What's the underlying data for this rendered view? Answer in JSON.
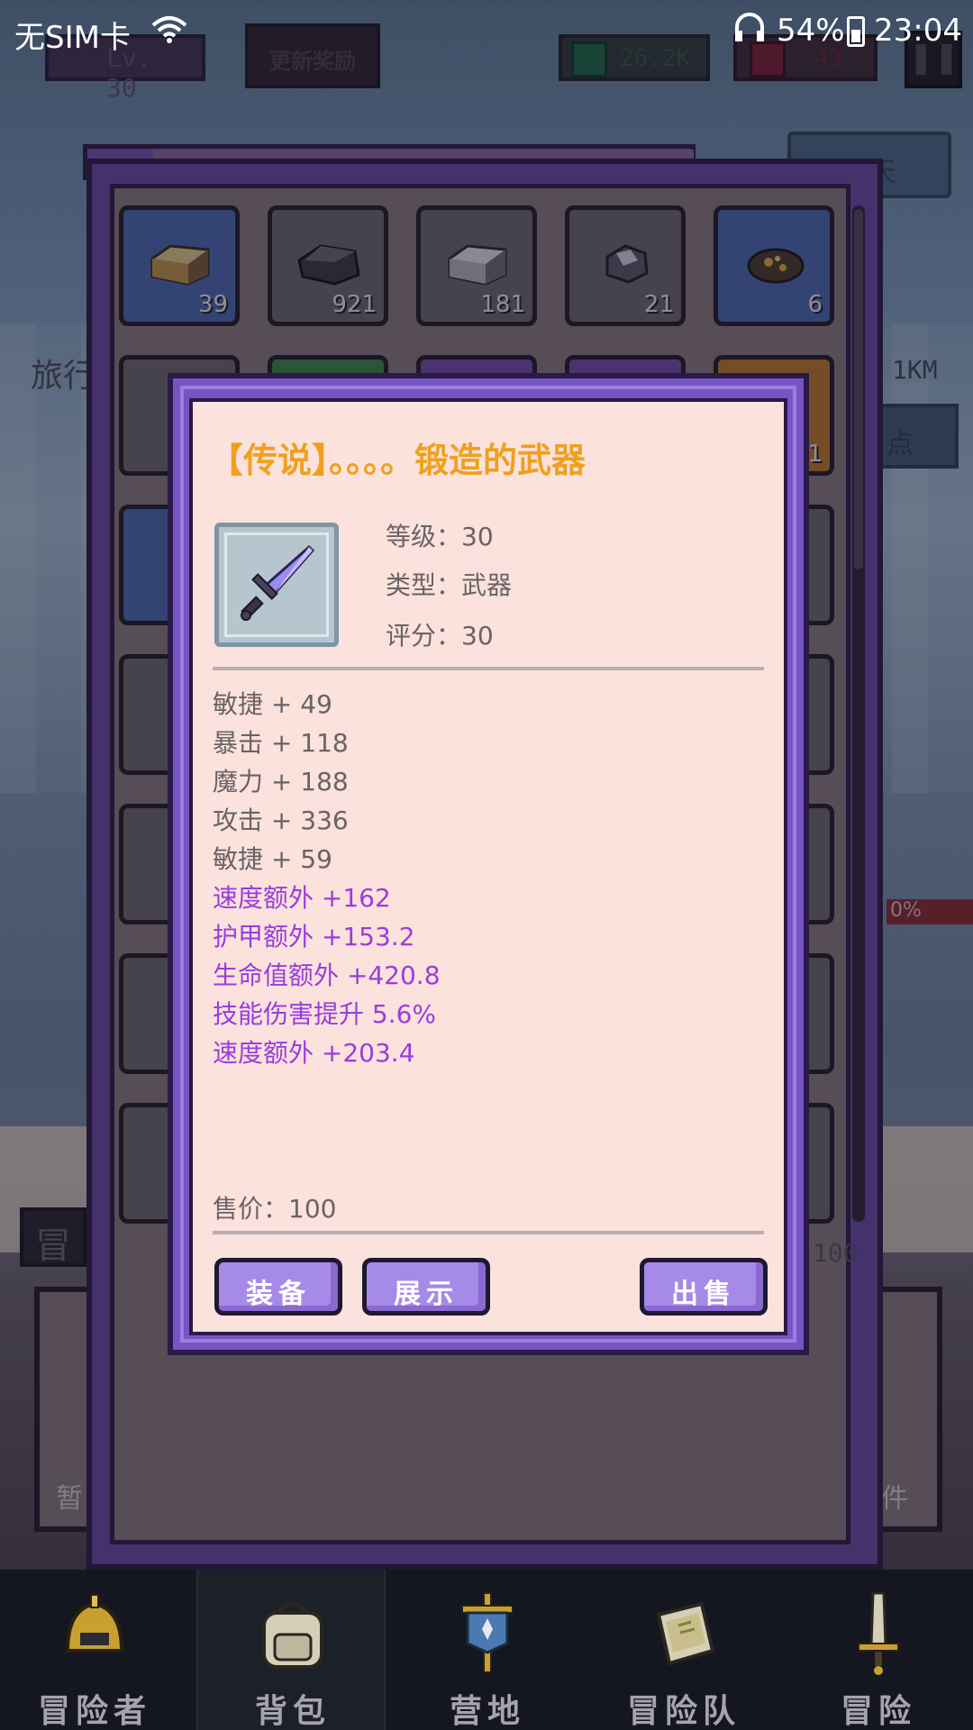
{
  "status_bar": {
    "carrier": "无SIM卡",
    "battery": "54%",
    "time": "23:04"
  },
  "hud": {
    "level": "Lv. 30",
    "event_button": "更新奖励",
    "gems": "26.2K",
    "rubies": "43"
  },
  "side": {
    "chat": "聊天",
    "travel": "旅行",
    "distance": "1KM",
    "right_button": "点",
    "percent": "0%",
    "adventure_short": "冒",
    "capacity": "100",
    "left_chip": "暂",
    "right_chip": "件"
  },
  "backpack": {
    "slots_row1": [
      {
        "count": "39",
        "tier": "blue",
        "material": "gold-ingot"
      },
      {
        "count": "921",
        "tier": "gray",
        "material": "coal"
      },
      {
        "count": "181",
        "tier": "gray",
        "material": "iron-ingot"
      },
      {
        "count": "21",
        "tier": "gray",
        "material": "silver-ore"
      },
      {
        "count": "6",
        "tier": "blue",
        "material": "gold-ore"
      }
    ],
    "slots_row2": [
      {
        "count": "",
        "tier": "gray"
      },
      {
        "count": "",
        "tier": "green"
      },
      {
        "count": "",
        "tier": "purple"
      },
      {
        "count": "",
        "tier": "purple"
      },
      {
        "count": "1",
        "tier": "orange"
      }
    ]
  },
  "item_detail": {
    "title": "【传说】。。。。锻造的武器",
    "title_color": "#f0a020",
    "icon": "sword-icon",
    "level_label": "等级：30",
    "type_label": "类型：武器",
    "score_label": "评分：30",
    "base_attrs": [
      "敏捷 + 49",
      "暴击 + 118",
      "魔力 + 188",
      "攻击 + 336",
      "敏捷 + 59"
    ],
    "bonus_attrs": [
      "速度额外 +162",
      "护甲额外 +153.2",
      "生命值额外 +420.8",
      "技能伤害提升 5.6%",
      "速度额外 +203.4"
    ],
    "bonus_color": "#9a3ce0",
    "price": "售价：100",
    "buttons": {
      "equip": "装备",
      "show": "展示",
      "sell": "出售"
    }
  },
  "nav": {
    "items": [
      "冒险者",
      "背包",
      "营地",
      "冒险队",
      "冒险"
    ],
    "active": "背包"
  }
}
